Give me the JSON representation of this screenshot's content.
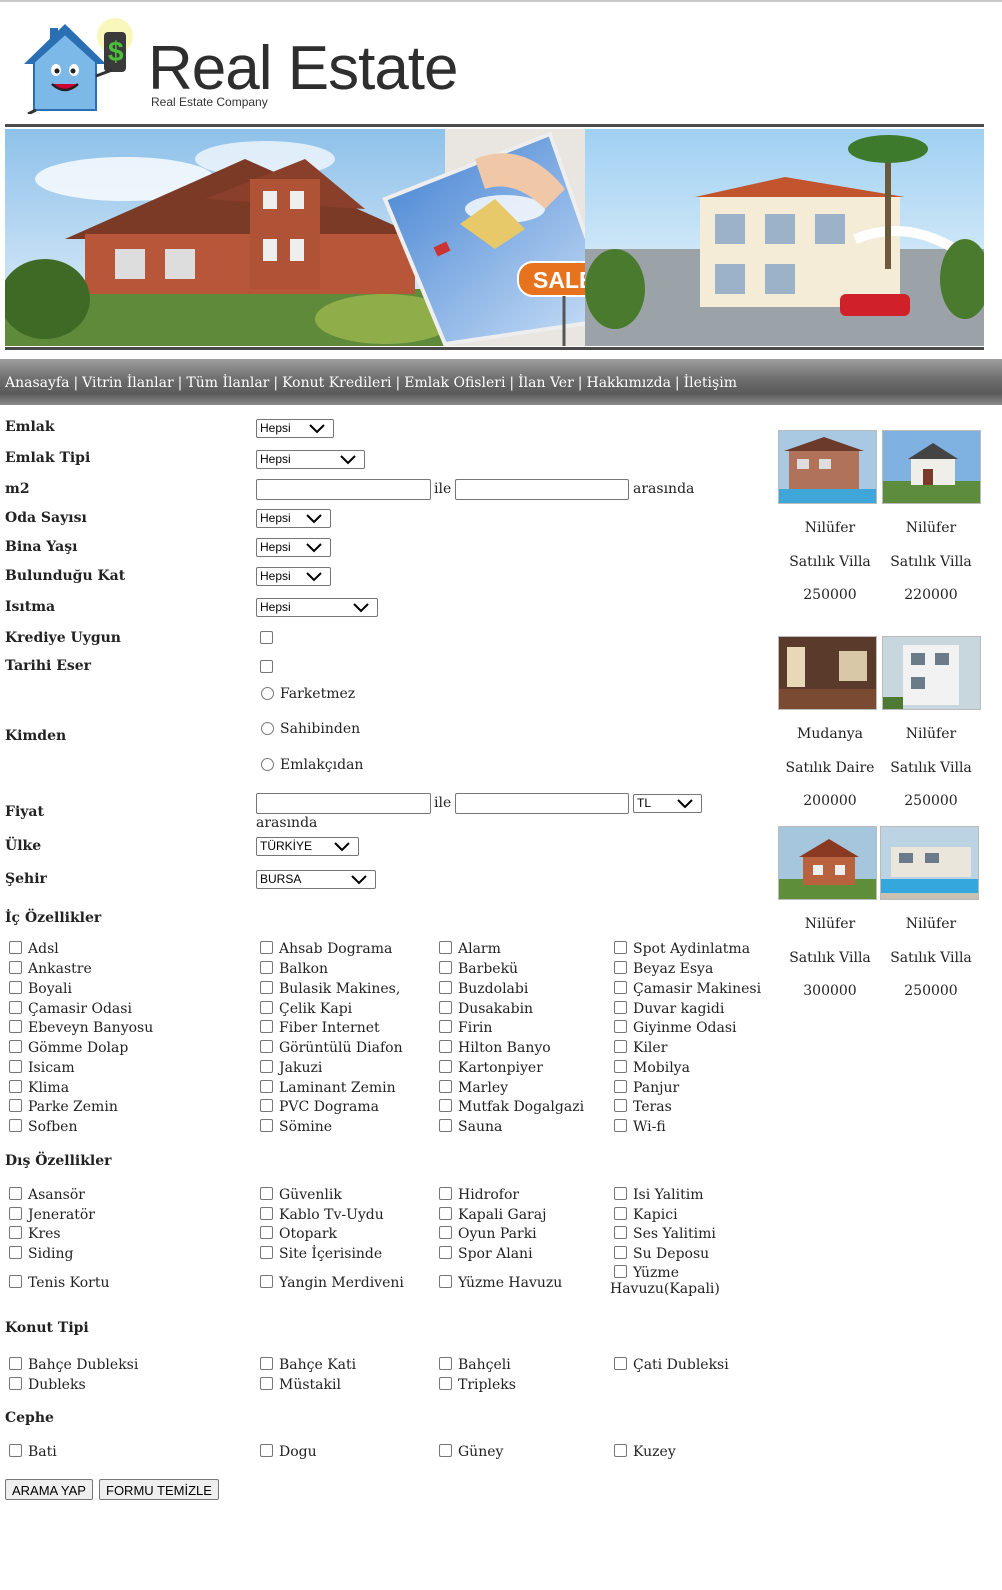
{
  "header": {
    "brand": "Real Estate",
    "subtitle": "Real Estate Company",
    "banner_sale_label": "SALE",
    "banner_sign_label": "SALE"
  },
  "nav": {
    "items": [
      "Anasayfa",
      "Vitrin İlanlar",
      "Tüm İlanlar",
      "Konut Kredileri",
      "Emlak Ofisleri",
      "İlan Ver",
      "Hakkımızda",
      "İletişim"
    ],
    "separator": "|"
  },
  "form": {
    "emlak": {
      "label": "Emlak",
      "value": "Hepsi"
    },
    "emlak_tipi": {
      "label": "Emlak Tipi",
      "value": "Hepsi"
    },
    "m2": {
      "label": "m2",
      "between": "ile",
      "suffix": "arasında",
      "min": "",
      "max": ""
    },
    "oda_sayisi": {
      "label": "Oda Sayısı",
      "value": "Hepsi"
    },
    "bina_yasi": {
      "label": "Bina Yaşı",
      "value": "Hepsi"
    },
    "bulundugu_kat": {
      "label": "Bulunduğu Kat",
      "value": "Hepsi"
    },
    "isitma": {
      "label": "Isıtma",
      "value": "Hepsi"
    },
    "krediye_uygun": {
      "label": "Krediye Uygun",
      "checked": false
    },
    "tarihi_eser": {
      "label": "Tarihi Eser",
      "checked": false
    },
    "kimden": {
      "label": "Kimden",
      "options": [
        "Farketmez",
        "Sahibinden",
        "Emlakçıdan"
      ]
    },
    "fiyat": {
      "label": "Fiyat",
      "between": "ile",
      "suffix": "arasında",
      "currency": "TL",
      "min": "",
      "max": ""
    },
    "ulke": {
      "label": "Ülke",
      "value": "TÜRKİYE"
    },
    "sehir": {
      "label": "Şehir",
      "value": "BURSA"
    }
  },
  "ic_ozellikler": {
    "title": "İç Özellikler",
    "columns": [
      [
        "Adsl",
        "Ankastre",
        "Boyali",
        "Çamasir Odasi",
        "Ebeveyn Banyosu",
        "Gömme Dolap",
        "Isicam",
        "Klima",
        "Parke Zemin",
        "Sofben"
      ],
      [
        "Ahsab Dograma",
        "Balkon",
        "Bulasik Makines,",
        "Çelik Kapi",
        "Fiber Internet",
        "Görüntülü Diafon",
        "Jakuzi",
        "Laminant Zemin",
        "PVC Dograma",
        "Sömine"
      ],
      [
        "Alarm",
        "Barbekü",
        "Buzdolabi",
        "Dusakabin",
        "Firin",
        "Hilton Banyo",
        "Kartonpiyer",
        "Marley",
        "Mutfak Dogalgazi",
        "Sauna"
      ],
      [
        "Spot Aydinlatma",
        "Beyaz Esya",
        "Çamasir Makinesi",
        "Duvar kagidi",
        "Giyinme Odasi",
        "Kiler",
        "Mobilya",
        "Panjur",
        "Teras",
        "Wi-fi"
      ]
    ]
  },
  "dis_ozellikler": {
    "title": "Dış Özellikler",
    "columns": [
      [
        "Asansör",
        "Jeneratör",
        "Kres",
        "Siding",
        "Tenis Kortu"
      ],
      [
        "Güvenlik",
        "Kablo Tv-Uydu",
        "Otopark",
        "Site İçerisinde",
        "Yangin Merdiveni"
      ],
      [
        "Hidrofor",
        "Kapali Garaj",
        "Oyun Parki",
        "Spor Alani",
        "Yüzme Havuzu"
      ],
      [
        "Isi Yalitim",
        "Kapici",
        "Ses Yalitimi",
        "Su Deposu",
        "Yüzme Havuzu(Kapali)"
      ]
    ]
  },
  "konut_tipi": {
    "title": "Konut Tipi",
    "columns": [
      [
        "Bahçe Dubleksi",
        "Dubleks"
      ],
      [
        "Bahçe Kati",
        "Müstakil"
      ],
      [
        "Bahçeli",
        "Tripleks"
      ],
      [
        "Çati Dubleksi"
      ]
    ]
  },
  "cephe": {
    "title": "Cephe",
    "columns": [
      [
        "Bati"
      ],
      [
        "Dogu"
      ],
      [
        "Güney"
      ],
      [
        "Kuzey"
      ]
    ]
  },
  "buttons": {
    "search": "ARAMA YAP",
    "reset": "FORMU TEMİZLE"
  },
  "listings": [
    {
      "location": "Nilüfer",
      "type": "Satılık Villa",
      "price": "250000"
    },
    {
      "location": "Nilüfer",
      "type": "Satılık Villa",
      "price": "220000"
    },
    {
      "location": "Mudanya",
      "type": "Satılık Daire",
      "price": "200000"
    },
    {
      "location": "Nilüfer",
      "type": "Satılık Villa",
      "price": "250000"
    },
    {
      "location": "Nilüfer",
      "type": "Satılık Villa",
      "price": "300000"
    },
    {
      "location": "Nilüfer",
      "type": "Satılık Villa",
      "price": "250000"
    }
  ]
}
